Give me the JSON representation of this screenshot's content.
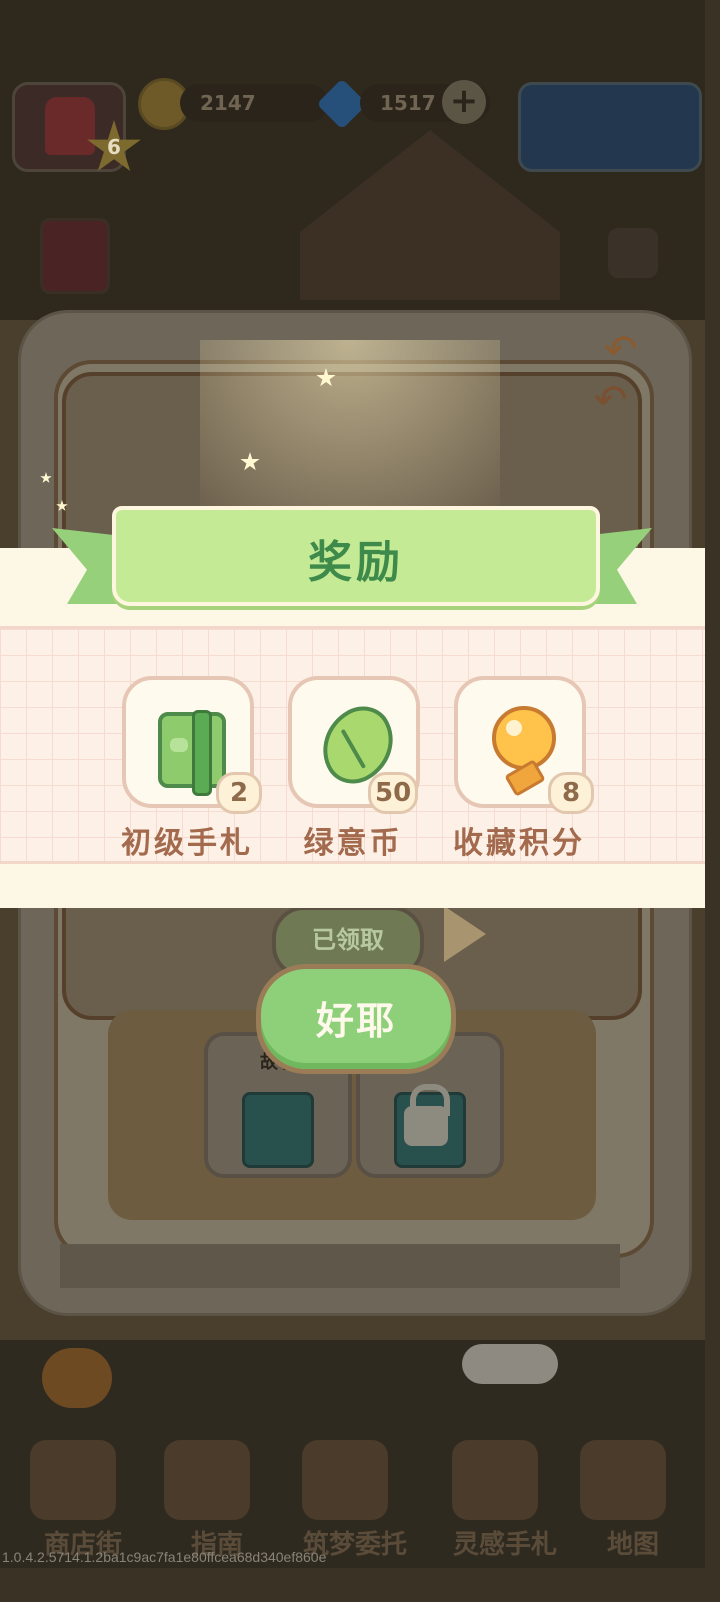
{
  "hud": {
    "coins": "2147",
    "gems": "1517",
    "level": "6"
  },
  "story_panel": {
    "claimed_label": "已领取",
    "chapter_label": "故事"
  },
  "reward_popup": {
    "title": "奖励",
    "items": [
      {
        "name": "初级手札",
        "count": "2",
        "icon": "green-notebook-icon"
      },
      {
        "name": "绿意币",
        "count": "50",
        "icon": "leaf-coin-icon"
      },
      {
        "name": "收藏积分",
        "count": "8",
        "icon": "lightbulb-icon"
      }
    ],
    "confirm_label": "好耶"
  },
  "bottom_nav": {
    "items": [
      {
        "label": "商店街",
        "icon": "shop-icon"
      },
      {
        "label": "指南",
        "icon": "guide-icon"
      },
      {
        "label": "筑梦委托",
        "icon": "commission-icon"
      },
      {
        "label": "灵感手札",
        "icon": "inspiration-notebook-icon"
      },
      {
        "label": "地图",
        "icon": "map-icon"
      }
    ]
  },
  "version": "1.0.4.2.5714.1.2ba1c9ac7fa1e80ffcea68d340ef860e",
  "colors": {
    "ribbon": "#c4ea96",
    "ribbon_text": "#3e8a4a",
    "confirm_button": "#8ed07a",
    "reward_name": "#a36a4e"
  }
}
